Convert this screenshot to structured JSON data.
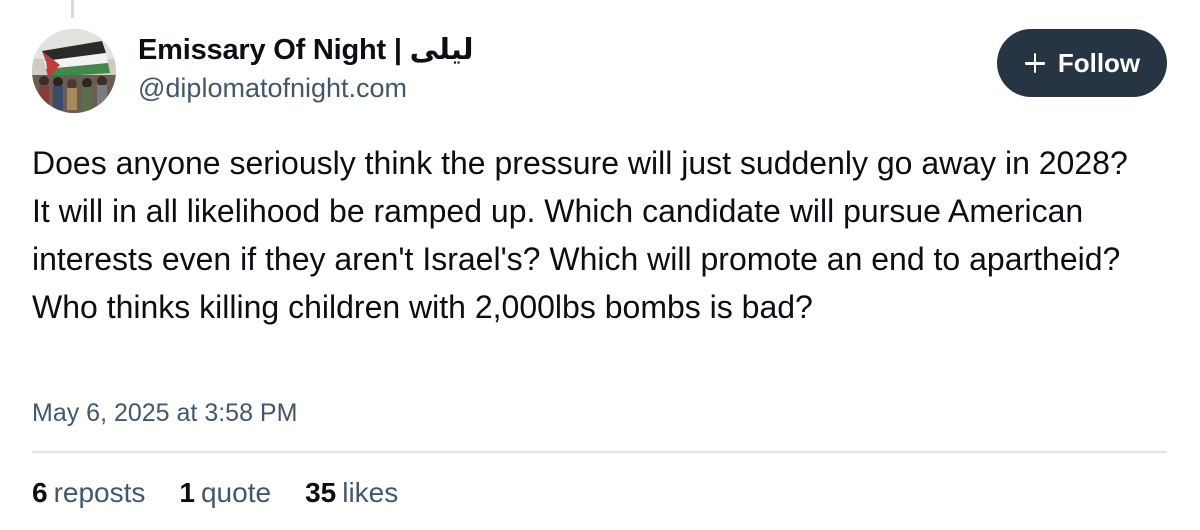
{
  "author": {
    "display_name": "Emissary Of Night | ليلى",
    "handle": "@diplomatofnight.com",
    "avatar_icon": "avatar-photo-flag-crowd"
  },
  "follow_button": {
    "label": "Follow",
    "icon": "plus-icon"
  },
  "post": {
    "text": "Does anyone seriously think the pressure will just suddenly go away in 2028? It will in all likelihood be ramped up. Which candidate will pursue American interests even if they aren't Israel's? Which will promote an end to apartheid? Who thinks killing children with 2,000lbs bombs is bad?",
    "timestamp": "May 6, 2025 at 3:58 PM"
  },
  "stats": {
    "reposts": {
      "count": "6",
      "label": "reposts"
    },
    "quotes": {
      "count": "1",
      "label": "quote"
    },
    "likes": {
      "count": "35",
      "label": "likes"
    }
  },
  "colors": {
    "text_primary": "#0b0f14",
    "text_secondary": "#42576c",
    "follow_bg": "#263444",
    "divider": "#dfe4ea"
  }
}
